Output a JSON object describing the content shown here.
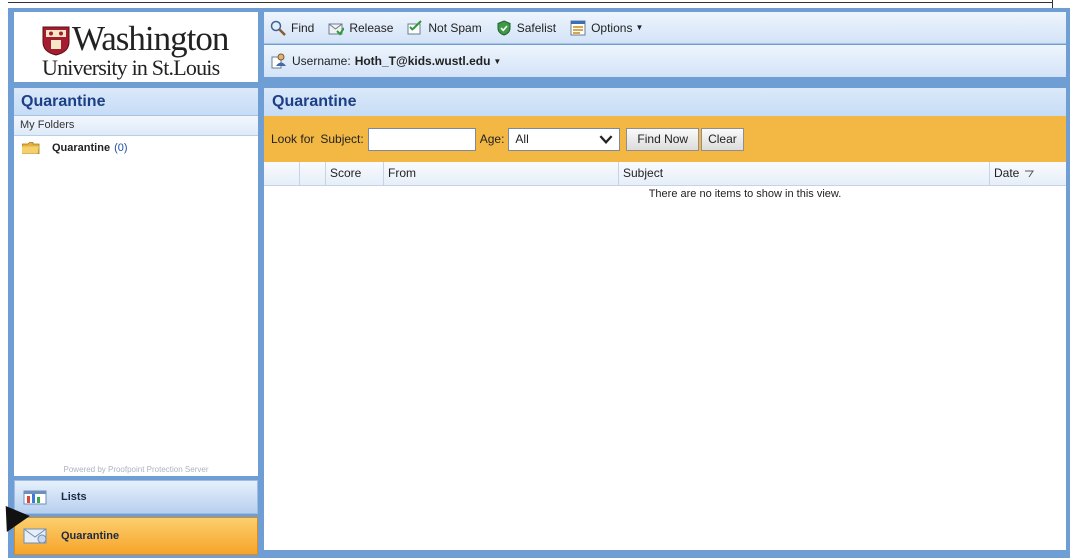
{
  "logo": {
    "line1": "Washington",
    "line2": "University in St.Louis"
  },
  "left_panel": {
    "title": "Quarantine",
    "section_label": "My Folders",
    "folders": [
      {
        "label": "Quarantine",
        "count": "(0)"
      }
    ],
    "powered_by": "Powered by Proofpoint Protection Server"
  },
  "nav": {
    "lists_label": "Lists",
    "quarantine_label": "Quarantine"
  },
  "toolbar": {
    "find": "Find",
    "release": "Release",
    "not_spam": "Not Spam",
    "safelist": "Safelist",
    "options": "Options",
    "username_label": "Username:",
    "username_value": "Hoth_T@kids.wustl.edu"
  },
  "main": {
    "title": "Quarantine",
    "search": {
      "look_for": "Look for",
      "subject_label": "Subject:",
      "subject_value": "",
      "age_label": "Age:",
      "age_value": "All",
      "find_now": "Find Now",
      "clear": "Clear"
    },
    "columns": [
      "Score",
      "From",
      "Subject",
      "Date"
    ],
    "empty_message": "There are no items to show in this view."
  }
}
